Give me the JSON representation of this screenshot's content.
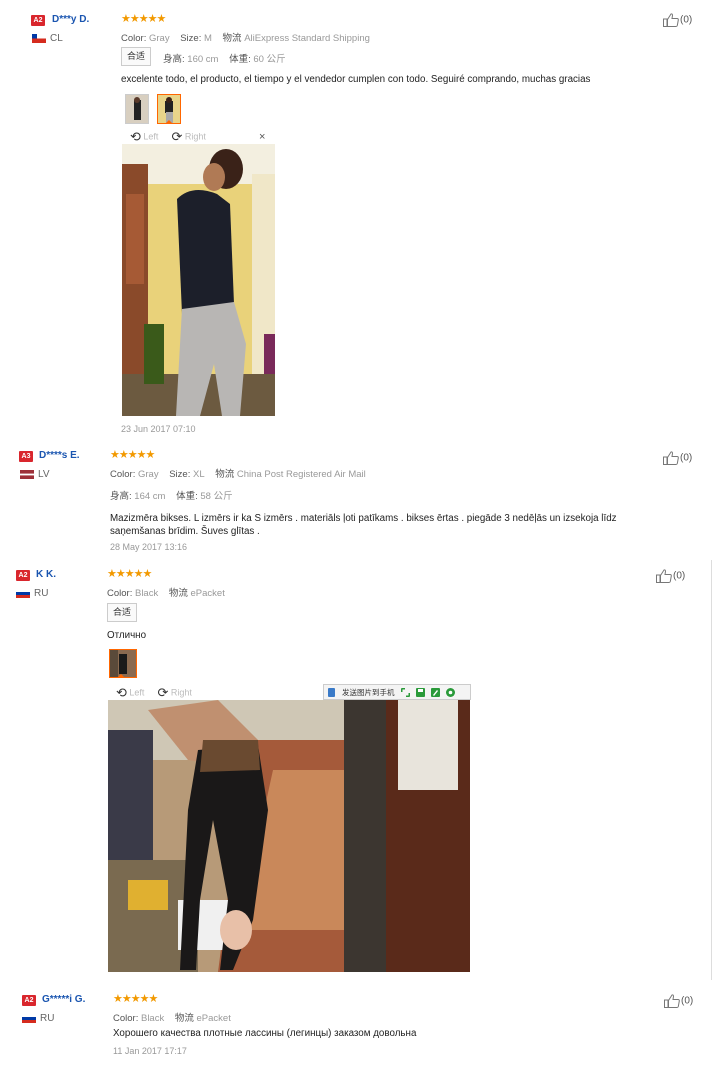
{
  "labels": {
    "color": "Color:",
    "size": "Size:",
    "logistics": "物流",
    "height": "身高:",
    "weight": "体重:",
    "fit": "合适",
    "rotate_left": "Left",
    "rotate_right": "Right",
    "close": "×",
    "send_to_phone": "发送图片到手机"
  },
  "reviews": [
    {
      "badge": "A2",
      "user": "D***y D.",
      "country": "CL",
      "stars": "★★★★★",
      "color": "Gray",
      "size": "M",
      "shipping": "AliExpress Standard Shipping",
      "height": "160 cm",
      "weight": "60 公斤",
      "text": "excelente todo, el producto, el tiempo y el vendedor cumplen con todo. Seguiré comprando, muchas gracias",
      "date": "23 Jun 2017 07:10",
      "helpful": "(0)"
    },
    {
      "badge": "A3",
      "user": "D****s E.",
      "country": "LV",
      "stars": "★★★★★",
      "color": "Gray",
      "size": "XL",
      "shipping": "China Post Registered Air Mail",
      "height": "164 cm",
      "weight": "58 公斤",
      "text": "Mazizmēra bikses. L izmērs ir ka S izmērs . materiāls ļoti patīkams . bikses ērtas . piegāde 3 nedēļās un izsekoja līdz saņemšanas brīdim. Šuves glītas .",
      "date": "28 May 2017 13:16",
      "helpful": "(0)"
    },
    {
      "badge": "A2",
      "user": "K K.",
      "country": "RU",
      "stars": "★★★★★",
      "color": "Black",
      "shipping": "ePacket",
      "text": "Отлично",
      "helpful": "(0)"
    },
    {
      "badge": "A2",
      "user": "G*****i G.",
      "country": "RU",
      "stars": "★★★★★",
      "color": "Black",
      "shipping": "ePacket",
      "text": "Хорошего качества плотные лассины (легинцы) заказом довольна",
      "date": "11 Jan 2017 17:17",
      "helpful": "(0)"
    }
  ],
  "colors": {
    "star": "#f29900",
    "username": "#1a55b0",
    "badge": "#d9262d"
  }
}
